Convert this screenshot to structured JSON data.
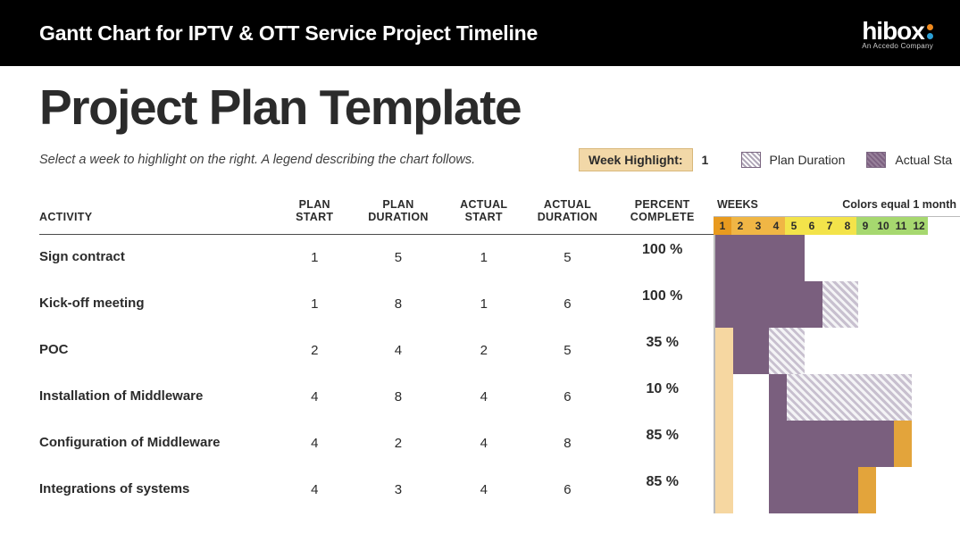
{
  "header": {
    "title": "Gantt Chart for IPTV & OTT Service Project Timeline",
    "logo_text": "hibox",
    "logo_sub": "An Accedo Company"
  },
  "page": {
    "title": "Project Plan Template",
    "instructions": "Select a week to highlight on the right. A legend describing the chart follows.",
    "week_highlight_label": "Week Highlight:",
    "week_highlight_value": "1",
    "legend_plan": "Plan Duration",
    "legend_actual": "Actual Sta"
  },
  "columns": {
    "activity": "ACTIVITY",
    "plan_start": "PLAN START",
    "plan_duration": "PLAN DURATION",
    "actual_start": "ACTUAL START",
    "actual_duration": "ACTUAL DURATION",
    "percent_complete": "PERCENT COMPLETE",
    "weeks": "WEEKS",
    "colors_note": "Colors equal 1 month"
  },
  "weeks": [
    "1",
    "2",
    "3",
    "4",
    "5",
    "6",
    "7",
    "8",
    "9",
    "10",
    "11",
    "12"
  ],
  "rows": [
    {
      "activity": "Sign contract",
      "plan_start": "1",
      "plan_duration": "5",
      "actual_start": "1",
      "actual_duration": "5",
      "percent": "100 %"
    },
    {
      "activity": "Kick-off meeting",
      "plan_start": "1",
      "plan_duration": "8",
      "actual_start": "1",
      "actual_duration": "6",
      "percent": "100 %"
    },
    {
      "activity": "POC",
      "plan_start": "2",
      "plan_duration": "4",
      "actual_start": "2",
      "actual_duration": "5",
      "percent": "35 %"
    },
    {
      "activity": "Installation of Middleware",
      "plan_start": "4",
      "plan_duration": "8",
      "actual_start": "4",
      "actual_duration": "6",
      "percent": "10 %"
    },
    {
      "activity": "Configuration of Middleware",
      "plan_start": "4",
      "plan_duration": "2",
      "actual_start": "4",
      "actual_duration": "8",
      "percent": "85 %"
    },
    {
      "activity": "Integrations of systems",
      "plan_start": "4",
      "plan_duration": "3",
      "actual_start": "4",
      "actual_duration": "6",
      "percent": "85 %"
    }
  ],
  "chart_data": {
    "type": "bar",
    "title": "Project Plan Template",
    "xlabel": "WEEKS",
    "ylabel": "ACTIVITY",
    "x": [
      1,
      2,
      3,
      4,
      5,
      6,
      7,
      8,
      9,
      10,
      11,
      12
    ],
    "highlighted_week": 1,
    "month_colors": {
      "1-4": "orange",
      "5-8": "yellow",
      "9-12": "green"
    },
    "series": [
      {
        "name": "Plan Duration",
        "style": "hatched",
        "data": [
          {
            "activity": "Sign contract",
            "start": 1,
            "duration": 5
          },
          {
            "activity": "Kick-off meeting",
            "start": 1,
            "duration": 8
          },
          {
            "activity": "POC",
            "start": 2,
            "duration": 4
          },
          {
            "activity": "Installation of Middleware",
            "start": 4,
            "duration": 8
          },
          {
            "activity": "Configuration of Middleware",
            "start": 4,
            "duration": 2
          },
          {
            "activity": "Integrations of systems",
            "start": 4,
            "duration": 3
          }
        ]
      },
      {
        "name": "Actual",
        "style": "solid-purple",
        "data": [
          {
            "activity": "Sign contract",
            "start": 1,
            "duration": 5
          },
          {
            "activity": "Kick-off meeting",
            "start": 1,
            "duration": 6
          },
          {
            "activity": "POC",
            "start": 2,
            "duration": 5
          },
          {
            "activity": "Installation of Middleware",
            "start": 4,
            "duration": 6
          },
          {
            "activity": "Configuration of Middleware",
            "start": 4,
            "duration": 8
          },
          {
            "activity": "Integrations of systems",
            "start": 4,
            "duration": 6
          }
        ]
      },
      {
        "name": "Percent Complete",
        "style": "solid-orange",
        "data": [
          {
            "activity": "Sign contract",
            "percent": 100
          },
          {
            "activity": "Kick-off meeting",
            "percent": 100
          },
          {
            "activity": "POC",
            "percent": 35
          },
          {
            "activity": "Installation of Middleware",
            "percent": 10
          },
          {
            "activity": "Configuration of Middleware",
            "percent": 85
          },
          {
            "activity": "Integrations of systems",
            "percent": 85
          }
        ]
      }
    ]
  }
}
